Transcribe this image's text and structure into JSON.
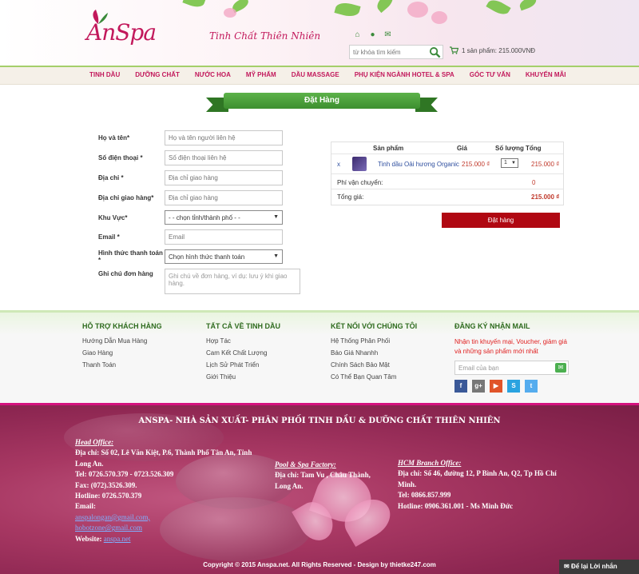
{
  "header": {
    "logo_text": "AnSpa",
    "tagline": "Tinh Chất Thiên Nhiên",
    "search_placeholder": "từ khóa tìm kiếm",
    "cart_text": "1 sản phẩm: 215.000VNĐ",
    "icons": [
      "home-icon",
      "location-icon",
      "mail-icon"
    ]
  },
  "nav": {
    "items": [
      "TINH DẦU",
      "DƯỠNG CHẤT",
      "NƯỚC HOA",
      "MỸ PHẨM",
      "DẦU MASSAGE",
      "PHỤ KIỆN NGÀNH HOTEL & SPA",
      "GÓC TƯ VẤN",
      "KHUYẾN MÃI"
    ]
  },
  "page": {
    "title": "Đặt Hàng"
  },
  "form": {
    "name_label": "Họ và tên*",
    "name_placeholder": "Họ và tên người liên hệ",
    "phone_label": "Số điện thoại *",
    "phone_placeholder": "Số điện thoại liên hệ",
    "address_label": "Địa chỉ *",
    "address_placeholder": "Địa chỉ giao hàng",
    "ship_label": "Địa chỉ giao hàng*",
    "ship_placeholder": "Địa chỉ giao hàng",
    "region_label": "Khu Vực*",
    "region_value": "- - chọn tỉnh/thành phố - -",
    "email_label": "Email *",
    "email_placeholder": "Email",
    "payment_label": "Hình thức thanh toán *",
    "payment_value": "Chọn hình thức thanh toán",
    "note_label": "Ghi chú đơn hàng",
    "note_placeholder": "Ghi chú về đơn hàng, ví dụ: lưu ý khi giao hàng."
  },
  "order": {
    "col_product": "Sản phẩm",
    "col_price": "Giá",
    "col_qty": "Số lượng",
    "col_total": "Tổng",
    "remove": "x",
    "product_name": "Tinh dầu Oải hương Organic",
    "price": "215.000 ₫",
    "qty": "1",
    "line_total": "215.000 ₫",
    "shipping_label": "Phí vận chuyển:",
    "shipping_value": "0",
    "total_label": "Tổng giá:",
    "total_value": "215.000 ₫",
    "submit_label": "Đặt hàng"
  },
  "footer_info": {
    "col1_title": "HỖ TRỢ KHÁCH HÀNG",
    "col1_links": [
      "Hướng Dẫn Mua Hàng",
      "Giao Hàng",
      "Thanh Toán"
    ],
    "col2_title": "TẤT CẢ VỀ TINH DẦU",
    "col2_links": [
      "Hợp Tác",
      "Cam Kết Chất Lượng",
      "Lịch Sử Phát Triển",
      "Giới Thiệu"
    ],
    "col3_title": "KẾT NỐI VỚI CHÚNG TÔI",
    "col3_links": [
      "Hệ Thống Phân Phối",
      "Báo Giá Nhanhh",
      "Chính Sách Bảo Mật",
      "Có Thể Bạn Quan Tâm"
    ],
    "col4_title": "ĐĂNG KÝ NHẬN MAIL",
    "promo": "Nhận tin khuyến mại, Voucher, giảm giá và những sản phẩm mới nhất",
    "email_placeholder": "Email của bạn",
    "social": [
      {
        "name": "facebook-icon",
        "glyph": "f",
        "color": "#3b5998"
      },
      {
        "name": "google-plus-icon",
        "glyph": "g+",
        "color": "#777777"
      },
      {
        "name": "youtube-icon",
        "glyph": "▶",
        "color": "#e0542a"
      },
      {
        "name": "skype-icon",
        "glyph": "S",
        "color": "#2aa3e0"
      },
      {
        "name": "twitter-icon",
        "glyph": "t",
        "color": "#55acee"
      }
    ]
  },
  "footer": {
    "company": "ANSPA- NHÀ SẢN XUẤT- PHÂN PHỐI TINH DẦU & DƯỠNG CHẤT THIÊN NHIÊN",
    "head_office_title": "Head Office:",
    "head_office_lines": [
      "Địa chỉ: Số 02, Lê Văn Kiệt, P.6, Thành Phố Tân An, Tỉnh",
      "Long An.",
      "Tel: 0726.570.379  - 0723.526.309",
      "Fax: (072).3526.309.",
      "Hotline: 0726.570.379",
      "Email:"
    ],
    "emails": [
      "anspalongan@gmail.com,",
      "hobotzone@gmail.com"
    ],
    "website_label": "Website:",
    "website": "anspa.net",
    "factory_title": "Pool & Spa Factory:",
    "factory_lines": [
      "Địa chỉ: Tam Vu , Châu Thành,",
      "Long An."
    ],
    "hcm_title": "HCM Branch Office:",
    "hcm_lines": [
      "Địa chỉ: Số 46, đường 12, P Bình An, Q2,  Tp  Hồ Chí",
      "Minh.",
      "Tel: 0866.857.999",
      "Hotline: 0906.361.001 -  Ms Minh Đức"
    ],
    "copyright": "Copyright © 2015 Anspa.net. All Rights Reserved - Design by thietke247.com",
    "chat_label": "Để lại Lời nhắn"
  }
}
